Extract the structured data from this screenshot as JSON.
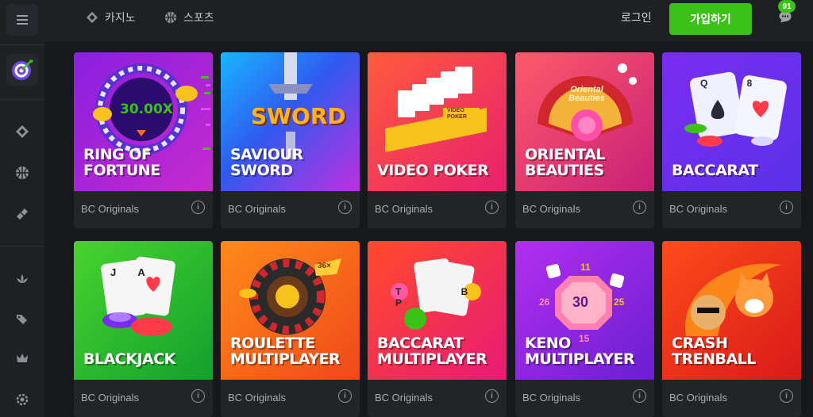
{
  "header": {
    "nav": [
      {
        "label": "카지노",
        "icon": "casino-icon"
      },
      {
        "label": "스포츠",
        "icon": "sports-icon"
      }
    ],
    "login_label": "로그인",
    "signup_label": "가입하기",
    "chat_badge": "91"
  },
  "sidebar": {
    "items": [
      {
        "icon": "menu-icon"
      },
      {
        "icon": "dartboard-icon"
      },
      {
        "icon": "casino-icon"
      },
      {
        "icon": "sports-icon"
      },
      {
        "icon": "ticket-icon"
      },
      {
        "icon": "lotus-icon"
      },
      {
        "icon": "tags-icon"
      },
      {
        "icon": "crown-icon"
      },
      {
        "icon": "settings-icon"
      }
    ]
  },
  "games": [
    {
      "title": "RING OF\nFORTUNE",
      "provider": "BC Originals",
      "info": "i",
      "art_text": "30.00X",
      "bg": [
        "#7a1fd6",
        "#c32ad0"
      ]
    },
    {
      "title": "SAVIOUR\nSWORD",
      "provider": "BC Originals",
      "info": "i",
      "art_text": "SWORD",
      "bg": [
        "#1f7bf2",
        "#b82fe0"
      ]
    },
    {
      "title": "VIDEO POKER",
      "provider": "BC Originals",
      "info": "i",
      "art_text": "VIDEO POKER",
      "bg": [
        "#f5405c",
        "#e0227a"
      ]
    },
    {
      "title": "ORIENTAL\nBEAUTIES",
      "provider": "BC Originals",
      "info": "i",
      "art_text": "Oriental Beauties",
      "bg": [
        "#ff4a78",
        "#c21f78"
      ]
    },
    {
      "title": "BACCARAT",
      "provider": "BC Originals",
      "info": "i",
      "art_text": "Q 8",
      "bg": [
        "#8a2cf0",
        "#5a2fe6"
      ]
    },
    {
      "title": "BLACKJACK",
      "provider": "BC Originals",
      "info": "i",
      "art_text": "J A",
      "bg": [
        "#3ec92a",
        "#0f9a2a"
      ]
    },
    {
      "title": "ROULETTE\nMULTIPLAYER",
      "provider": "BC Originals",
      "info": "i",
      "art_text": "36×",
      "bg": [
        "#ff7a1a",
        "#f04a12"
      ]
    },
    {
      "title": "BACCARAT\nMULTIPLAYER",
      "provider": "BC Originals",
      "info": "i",
      "art_text": "T B P",
      "bg": [
        "#ff3b30",
        "#e6167a"
      ]
    },
    {
      "title": "KENO\nMULTIPLAYER",
      "provider": "BC Originals",
      "info": "i",
      "art_text": "30",
      "bg": [
        "#a52ef0",
        "#6a1fd0"
      ]
    },
    {
      "title": "CRASH\nTRENBALL",
      "provider": "BC Originals",
      "info": "i",
      "art_text": "",
      "bg": [
        "#ff3b1f",
        "#d91a1a"
      ]
    }
  ],
  "keno_numbers": [
    "11",
    "26",
    "25",
    "15"
  ],
  "colors": {
    "accent": "#3bc117",
    "bg": "#17181b",
    "panel": "#1e2024",
    "card": "#222428"
  }
}
